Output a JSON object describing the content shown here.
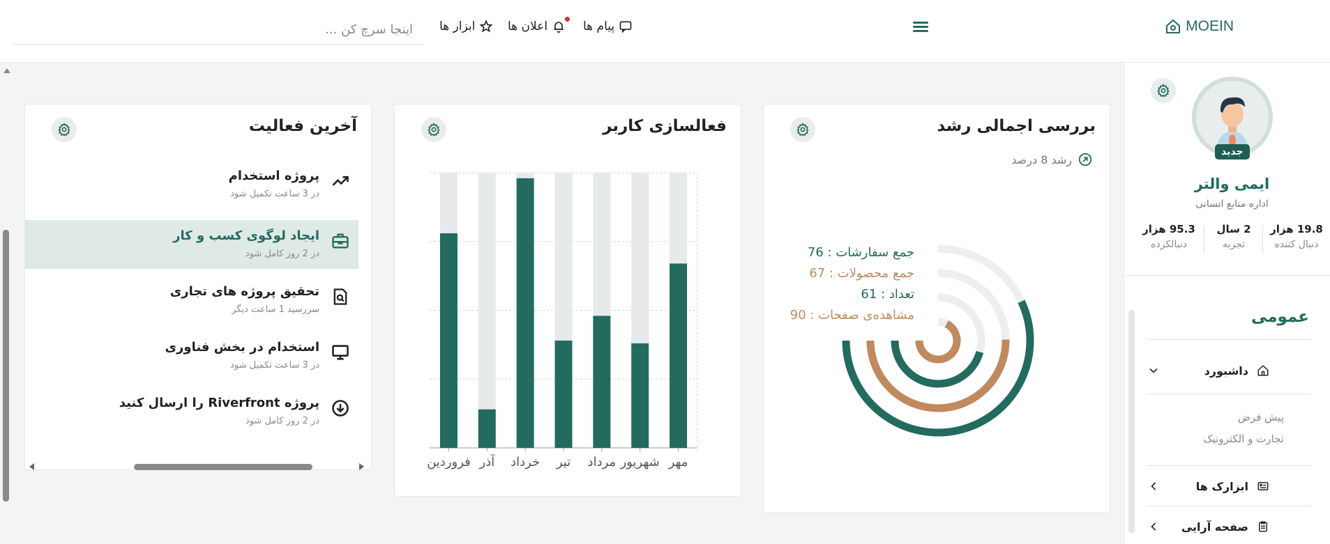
{
  "header": {
    "brand": "MOEIN",
    "nav": {
      "messages": "پیام ها",
      "notifications": "اعلان ها",
      "tools": "ابزار ها"
    },
    "search_placeholder": "اینجا سرچ کن ..."
  },
  "profile": {
    "badge": "جدید",
    "name": "ایمی والتر",
    "role": "اداره منابع انسانی",
    "stats": [
      {
        "value": "19.8 هزار",
        "label": "دنبال کننده"
      },
      {
        "value": "2 سال",
        "label": "تجربه"
      },
      {
        "value": "95.3 هزار",
        "label": "دنبالکرده"
      }
    ]
  },
  "sidebar": {
    "section": "عمومی",
    "dashboard": {
      "label": "داشبورد",
      "sub": [
        "پیش فرض",
        "تجارت و الکترونیک"
      ]
    },
    "items": [
      {
        "label": "ابزارک ها",
        "icon": "widget-icon"
      },
      {
        "label": "صفحه آرایی",
        "icon": "layout-icon"
      }
    ]
  },
  "growth": {
    "title": "بررسی اجمالی رشد",
    "subtitle": "رشد 8 درصد",
    "legend": [
      {
        "text": "جمع سفارشات : 76",
        "color": "#236b5e"
      },
      {
        "text": "جمع محصولات : 67",
        "color": "#c08a5e"
      },
      {
        "text": "تعداد : 61",
        "color": "#236b5e"
      },
      {
        "text": "مشاهده‌ی صفحات : 90",
        "color": "#c08a5e"
      }
    ]
  },
  "activation": {
    "title": "فعالسازی کاربر"
  },
  "activity": {
    "title": "آخرین فعالیت",
    "items": [
      {
        "title": "پروژه استخدام",
        "sub": "در 3 ساعت تکمیل شود",
        "icon": "trend-icon",
        "active": false
      },
      {
        "title": "ایجاد لوگوی کسب و کار",
        "sub": "در 2 روز کامل شود",
        "icon": "briefcase-icon",
        "active": true
      },
      {
        "title": "تحقیق پروژه های تجاری",
        "sub": "سررسید 1 ساعت دیگر",
        "icon": "search-doc-icon",
        "active": false
      },
      {
        "title": "استخدام در بخش فناوری",
        "sub": "در 3 ساعت تکمیل شود",
        "icon": "monitor-icon",
        "active": false
      },
      {
        "title": "پروژه Riverfront را ارسال کنید",
        "sub": "در 2 روز کامل شود",
        "icon": "download-icon",
        "active": false
      }
    ]
  },
  "chart_data": [
    {
      "type": "bar",
      "categories": [
        "مهر",
        "شهریور",
        "مرداد",
        "تیر",
        "خرداد",
        "آذر",
        "فروردین"
      ],
      "series": [
        {
          "values": [
            67,
            38,
            48,
            39,
            98,
            14,
            78
          ]
        }
      ],
      "ylim": [
        0,
        100
      ],
      "grid": true,
      "bar_color": "#236b5e",
      "track_color": "#e6eaeb"
    },
    {
      "type": "radialBar",
      "series": [
        {
          "name": "جمع سفارشات",
          "value": 76,
          "color": "#236b5e"
        },
        {
          "name": "جمع محصولات",
          "value": 67,
          "color": "#c08a5e"
        },
        {
          "name": "تعداد",
          "value": 61,
          "color": "#236b5e"
        },
        {
          "name": "مشاهده‌ی صفحات",
          "value": 90,
          "color": "#c08a5e"
        }
      ],
      "max": 100,
      "track_color": "#eeeeee"
    }
  ]
}
